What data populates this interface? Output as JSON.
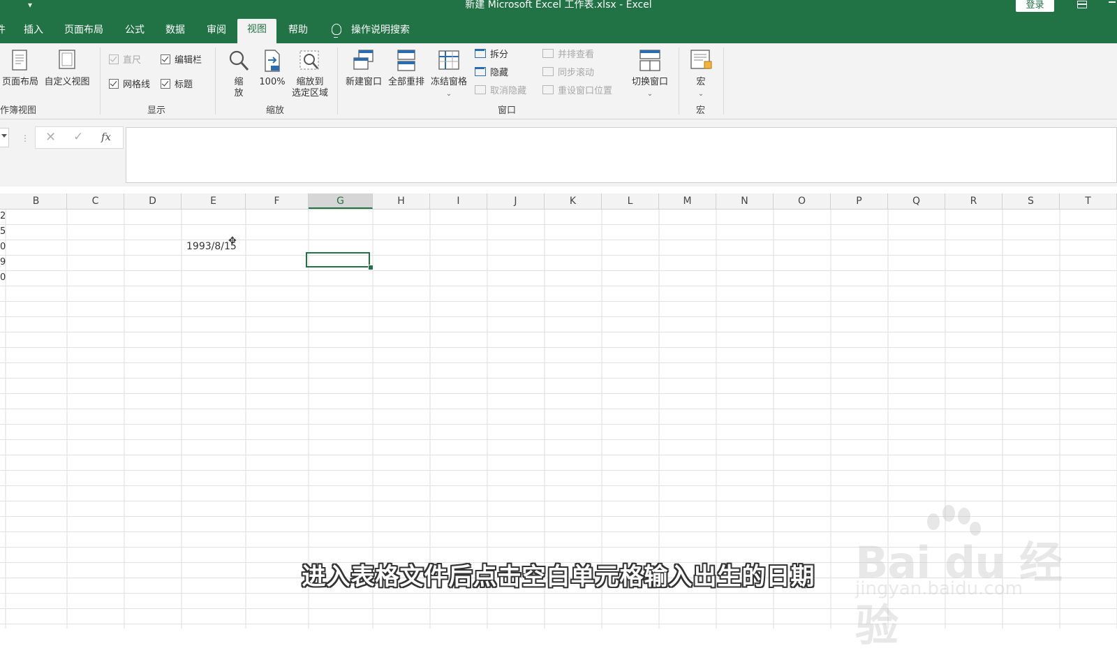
{
  "window": {
    "title": "新建 Microsoft Excel 工作表.xlsx  -  Excel",
    "login": "登录"
  },
  "tabs": {
    "partial": "件",
    "items": [
      "插入",
      "页面布局",
      "公式",
      "数据",
      "审阅",
      "视图",
      "帮助"
    ],
    "active": "视图",
    "search": "操作说明搜索"
  },
  "ribbon": {
    "workbook_views": {
      "page_layout": "页面布局",
      "custom_views": "自定义视图",
      "group_label": "作簿视图"
    },
    "show": {
      "ruler": "直尺",
      "formula_bar": "编辑栏",
      "gridlines": "网格线",
      "headings": "标题",
      "group_label": "显示"
    },
    "zoom": {
      "zoom_line1": "缩",
      "zoom_line2": "放",
      "hundred": "100%",
      "to_selection_line1": "缩放到",
      "to_selection_line2": "选定区域",
      "group_label": "缩放"
    },
    "window": {
      "new_window": "新建窗口",
      "arrange_all": "全部重排",
      "freeze_panes": "冻结窗格",
      "split": "拆分",
      "hide": "隐藏",
      "unhide": "取消隐藏",
      "side_by_side": "并排查看",
      "sync_scroll": "同步滚动",
      "reset_position": "重设窗口位置",
      "switch_windows": "切换窗口",
      "group_label": "窗口"
    },
    "macros": {
      "macros": "宏",
      "group_label": "宏"
    }
  },
  "formula_bar": {
    "fx": "fx",
    "value": ""
  },
  "grid": {
    "columns": [
      "B",
      "C",
      "D",
      "E",
      "F",
      "G",
      "H",
      "I",
      "J",
      "K",
      "L",
      "M",
      "N",
      "O",
      "P",
      "Q",
      "R",
      "S",
      "T"
    ],
    "active_column": "G",
    "row_fragments": [
      "2",
      "5",
      "0",
      "9",
      "0"
    ],
    "cell_e3": "1993/8/15"
  },
  "overlay": {
    "subtitle": "进入表格文件后点击空白单元格输入出生的日期",
    "watermark_brand": "Bai du 经验",
    "watermark_site": "jingyan.baidu.com"
  },
  "colors": {
    "excel_green": "#217346",
    "ribbon_bg": "#f3f3f3"
  }
}
